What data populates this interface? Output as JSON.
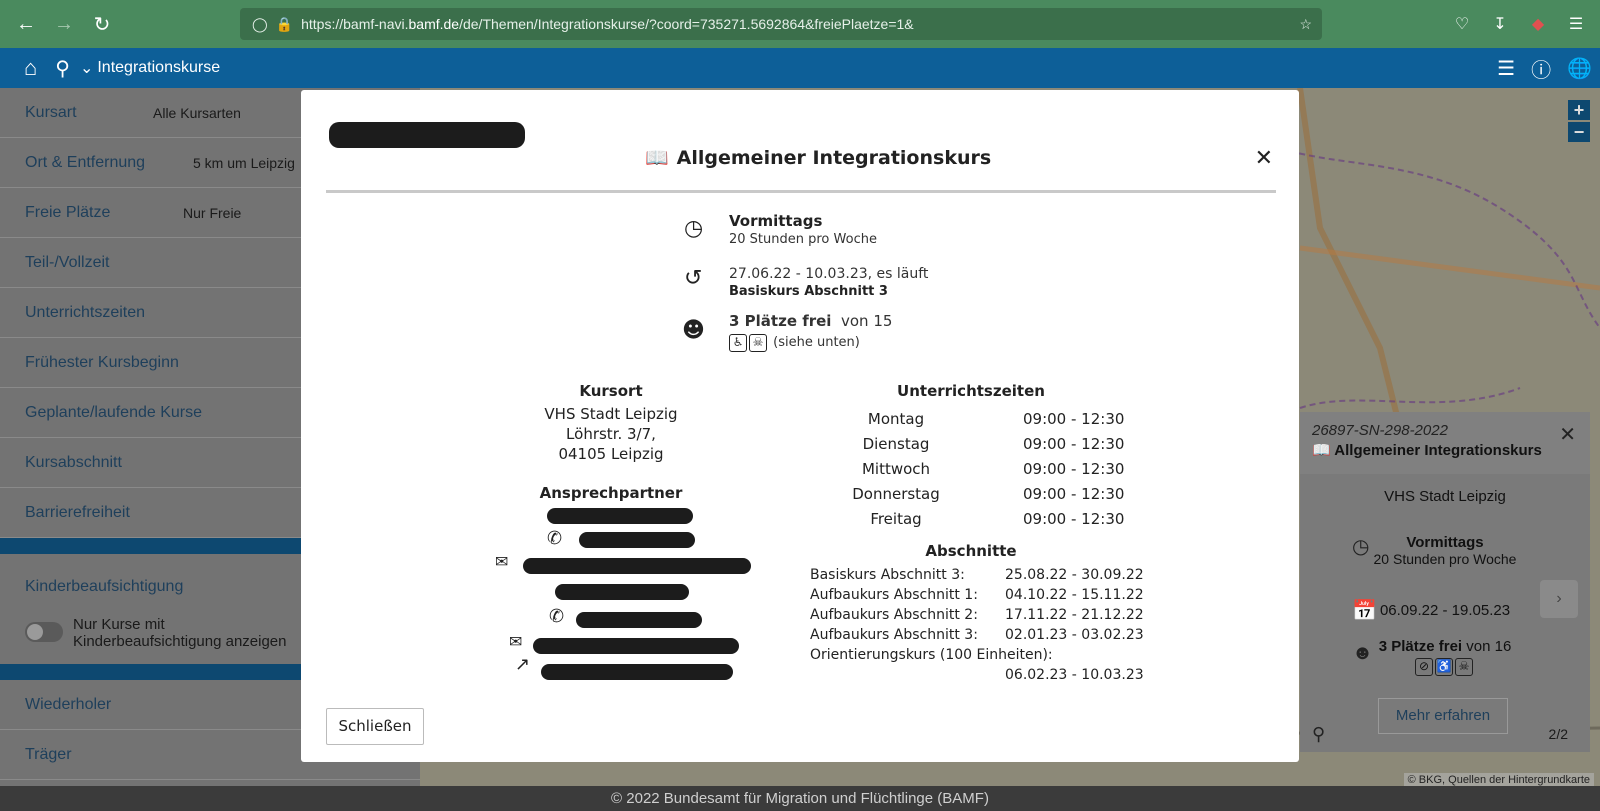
{
  "browser": {
    "url_prefix": "https://bamf-navi.",
    "url_host": "bamf.de",
    "url_rest": "/de/Themen/Integrationskurse/?coord=735271.5692864&freiePlaetze=1&"
  },
  "appbar": {
    "title": "Integrationskurse"
  },
  "sidebar": {
    "filters": [
      {
        "label": "Kursart",
        "value": "Alle Kursarten"
      },
      {
        "label": "Ort & Entfernung",
        "value": "5 km um Leipzig"
      },
      {
        "label": "Freie Plätze",
        "value": "Nur Freie"
      },
      {
        "label": "Teil-/Vollzeit",
        "value": ""
      },
      {
        "label": "Unterrichtszeiten",
        "value": ""
      },
      {
        "label": "Frühester Kursbeginn",
        "value": ""
      },
      {
        "label": "Geplante/laufende Kurse",
        "value": ""
      },
      {
        "label": "Kursabschnitt",
        "value": ""
      },
      {
        "label": "Barrierefreiheit",
        "value": ""
      }
    ],
    "kinder_label": "Kinderbeaufsichtigung",
    "kinder_toggle_text": "Nur Kurse mit Kinderbeaufsichtigung anzeigen",
    "bottom_items": [
      "Wiederholer",
      "Träger"
    ]
  },
  "map": {
    "popup": {
      "course_id": "26897-SN-298-2022",
      "title": "Allgemeiner Integrationskurs",
      "provider": "VHS Stadt Leipzig",
      "time_main": "Vormittags",
      "time_sub": "20 Stunden pro Woche",
      "dates": "06.09.22 - 19.05.23",
      "places_bold": "3 Plätze frei",
      "places_rest": "von 16",
      "button": "Mehr erfahren",
      "page": "2/2"
    },
    "copyright": "© BKG, Quellen der Hintergrundkarte"
  },
  "modal": {
    "title": "Allgemeiner Integrationskurs",
    "time_main": "Vormittags",
    "time_sub": "20 Stunden pro Woche",
    "period": "27.06.22 - 10.03.23,  es läuft",
    "section": "Basiskurs Abschnitt 3",
    "places_bold": "3 Plätze frei",
    "places_rest": "von 15",
    "places_note": "(siehe unten)",
    "kursort_title": "Kursort",
    "kursort_lines": [
      "VHS Stadt Leipzig",
      "Löhrstr. 3/7,",
      "04105 Leipzig"
    ],
    "contact_title": "Ansprechpartner",
    "schedule_title": "Unterrichtszeiten",
    "schedule": [
      {
        "day": "Montag",
        "time": "09:00 - 12:30"
      },
      {
        "day": "Dienstag",
        "time": "09:00 - 12:30"
      },
      {
        "day": "Mittwoch",
        "time": "09:00 - 12:30"
      },
      {
        "day": "Donnerstag",
        "time": "09:00 - 12:30"
      },
      {
        "day": "Freitag",
        "time": "09:00 - 12:30"
      }
    ],
    "sections_title": "Abschnitte",
    "sections": [
      {
        "name": "Basiskurs Abschnitt 3:",
        "dates": "25.08.22 - 30.09.22"
      },
      {
        "name": "Aufbaukurs Abschnitt 1:",
        "dates": "04.10.22 - 15.11.22"
      },
      {
        "name": "Aufbaukurs Abschnitt 2:",
        "dates": "17.11.22 - 21.12.22"
      },
      {
        "name": "Aufbaukurs Abschnitt 3:",
        "dates": "02.01.23 - 03.02.23"
      },
      {
        "name": "Orientierungskurs (100 Einheiten):",
        "dates": "06.02.23 - 10.03.23"
      }
    ],
    "close_button": "Schließen"
  },
  "footer": {
    "text": "© 2022 Bundesamt für Migration und Flüchtlinge (BAMF)"
  }
}
